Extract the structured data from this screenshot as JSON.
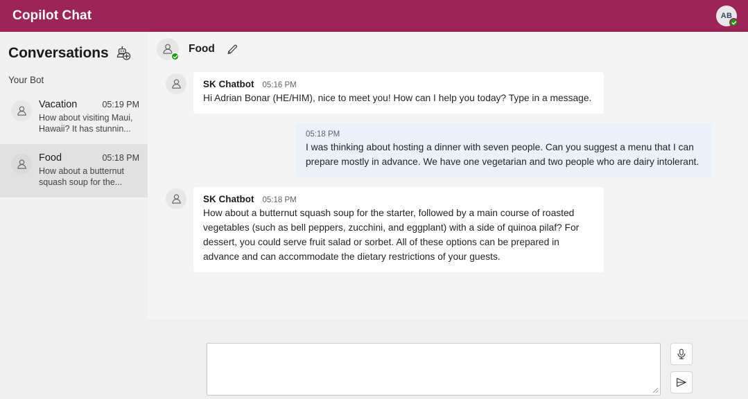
{
  "topbar": {
    "title": "Copilot Chat",
    "avatar_initials": "AB",
    "presence_status": "available"
  },
  "sidebar": {
    "title": "Conversations",
    "new_bot_icon": "robot-add-icon",
    "section_label": "Your Bot",
    "conversations": [
      {
        "name": "Vacation",
        "time": "05:19 PM",
        "preview": "How about visiting Maui, Hawaii? It has stunnin...",
        "selected": false
      },
      {
        "name": "Food",
        "time": "05:18 PM",
        "preview": "How about a butternut squash soup for the...",
        "selected": true
      }
    ]
  },
  "chat": {
    "header": {
      "title": "Food",
      "avatar_icon": "person-icon",
      "edit_icon": "pencil-icon",
      "presence_status": "available"
    },
    "messages": [
      {
        "role": "bot",
        "sender": "SK Chatbot",
        "time": "05:16 PM",
        "text": "Hi Adrian Bonar (HE/HIM), nice to meet you! How can I help you today? Type in a message."
      },
      {
        "role": "user",
        "sender": "",
        "time": "05:18 PM",
        "text": "I was thinking about hosting a dinner with seven people. Can you suggest a menu that I can prepare mostly in advance. We have one vegetarian and two people who are dairy intolerant."
      },
      {
        "role": "bot",
        "sender": "SK Chatbot",
        "time": "05:18 PM",
        "text": "How about a butternut squash soup for the starter, followed by a main course of roasted vegetables (such as bell peppers, zucchini, and eggplant) with a side of quinoa pilaf? For dessert, you could serve fruit salad or sorbet. All of these options can be prepared in advance and can accommodate the dietary restrictions of your guests."
      }
    ]
  },
  "composer": {
    "value": "",
    "placeholder": "",
    "mic_icon": "microphone-icon",
    "send_icon": "send-icon"
  },
  "colors": {
    "brand": "#9c2457",
    "presence_green": "#13a10e",
    "user_bubble": "#eaf1fb",
    "bot_bubble": "#ffffff",
    "panel": "#f4f4f4",
    "page": "#efefef",
    "sidebar": "#f0f0f0",
    "selected_item": "#e1e1e1"
  }
}
